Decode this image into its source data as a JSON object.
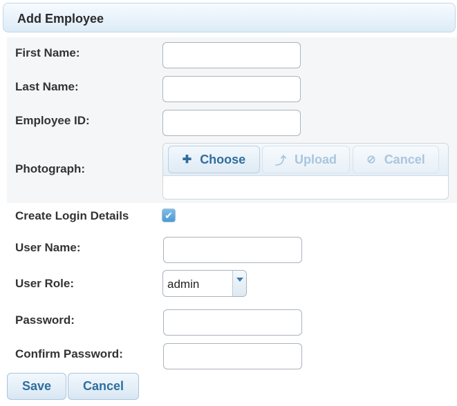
{
  "header": {
    "title": "Add Employee"
  },
  "form": {
    "first_name": {
      "label": "First Name:",
      "value": ""
    },
    "last_name": {
      "label": "Last Name:",
      "value": ""
    },
    "employee_id": {
      "label": "Employee ID:",
      "value": ""
    },
    "photograph": {
      "label": "Photograph:",
      "choose_label": "Choose",
      "upload_label": "Upload",
      "cancel_label": "Cancel",
      "choose_icon": "plus-icon",
      "upload_icon": "upload-icon",
      "cancel_icon": "cancel-icon"
    },
    "create_login": {
      "label": "Create Login Details",
      "checked": true
    },
    "user_name": {
      "label": "User Name:",
      "value": ""
    },
    "user_role": {
      "label": "User Role:",
      "value": "admin"
    },
    "password": {
      "label": "Password:",
      "value": ""
    },
    "confirm_password": {
      "label": "Confirm Password:",
      "value": ""
    }
  },
  "actions": {
    "save_label": "Save",
    "cancel_label": "Cancel"
  },
  "colors": {
    "accent": "#2e6e9e",
    "header_bg": "#dcebf7",
    "checkbox_fill": "#4e9ad3"
  }
}
